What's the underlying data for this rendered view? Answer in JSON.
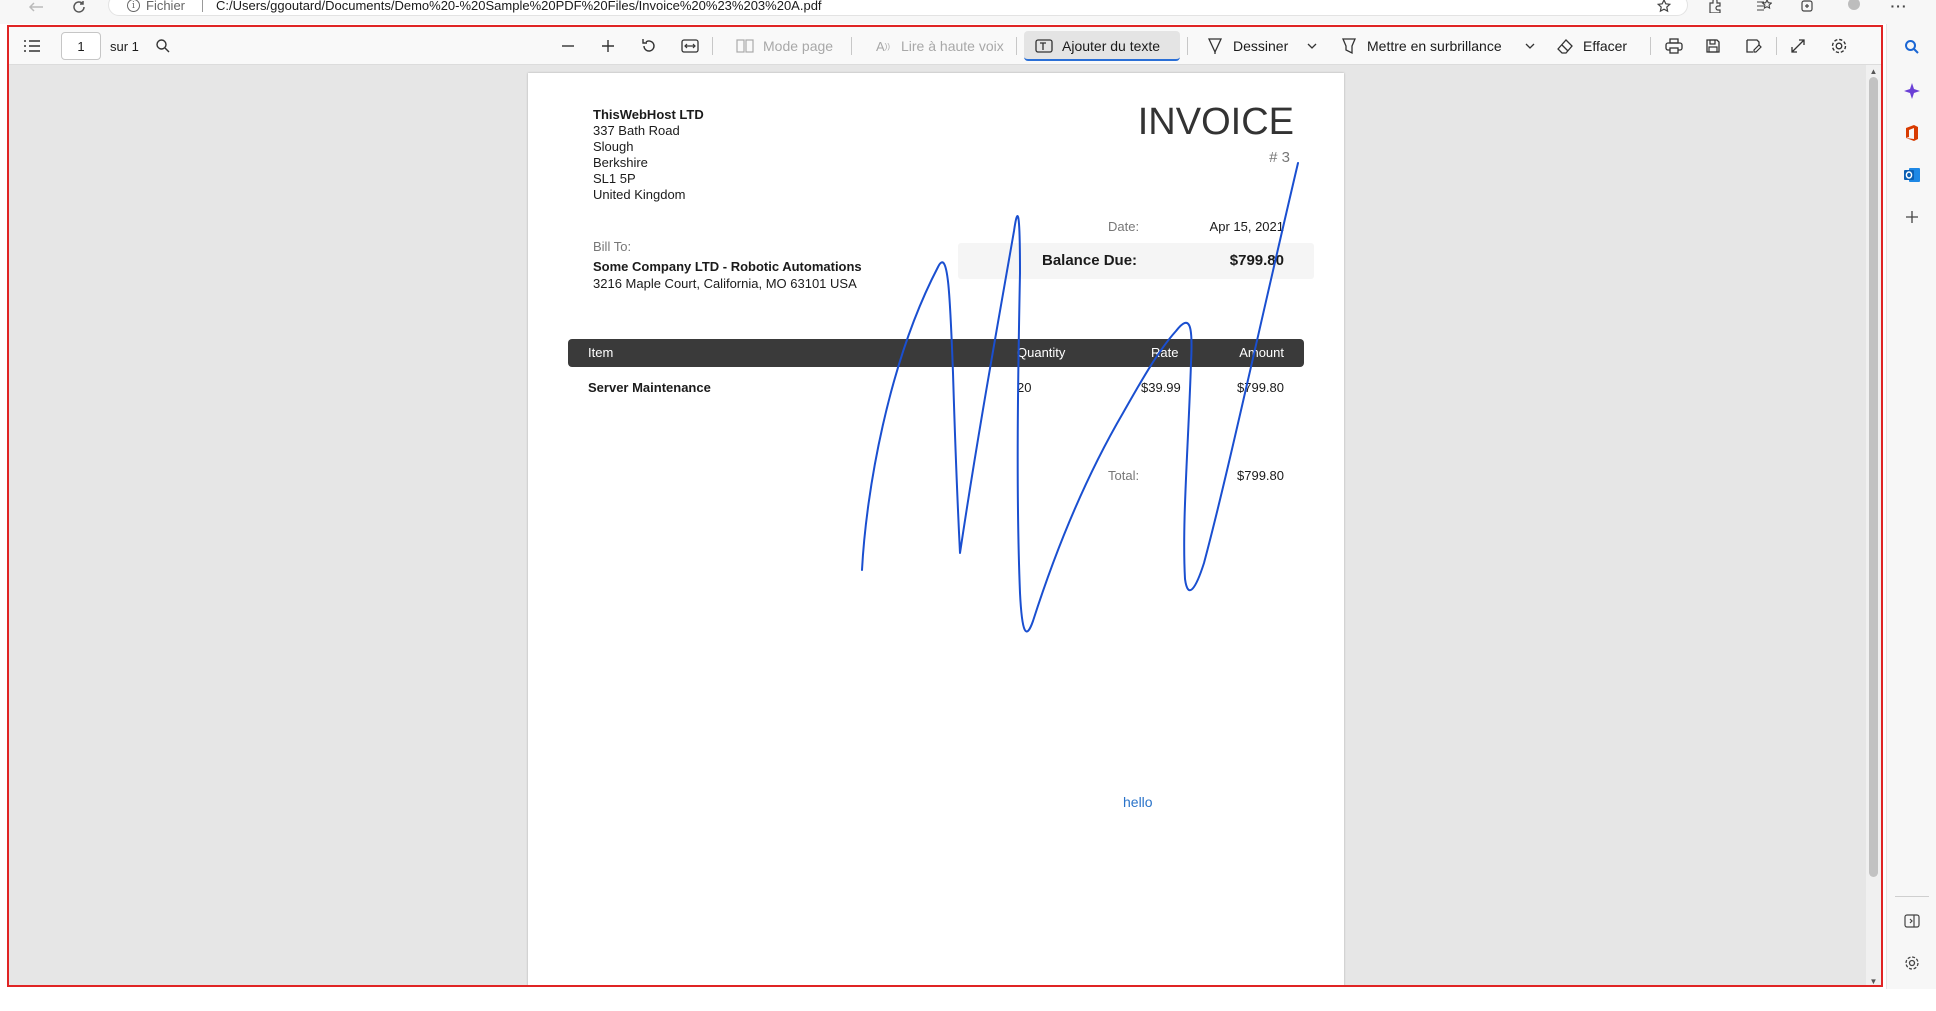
{
  "browser": {
    "url_label": "Fichier",
    "url": "C:/Users/ggoutard/Documents/Demo%20-%20Sample%20PDF%20Files/Invoice%20%23%203%20A.pdf",
    "menu_glyph": "···"
  },
  "toolbar": {
    "page_number": "1",
    "page_total": "sur 1",
    "mode_page": "Mode page",
    "read_aloud": "Lire à haute voix",
    "add_text": "Ajouter du texte",
    "draw": "Dessiner",
    "highlight": "Mettre en surbrillance",
    "erase": "Effacer"
  },
  "invoice": {
    "company": {
      "name": "ThisWebHost LTD",
      "address_lines": [
        "337 Bath Road",
        "Slough",
        "Berkshire",
        "SL1 5P",
        "United Kingdom"
      ]
    },
    "title": "INVOICE",
    "number": "# 3",
    "date_label": "Date:",
    "date_value": "Apr 15, 2021",
    "balance_label": "Balance Due:",
    "balance_value": "$799.80",
    "bill_to_label": "Bill To:",
    "bill_to_name": "Some Company LTD - Robotic Automations",
    "bill_to_address": "3216 Maple Court, California, MO 63101 USA",
    "table_headers": [
      "Item",
      "Quantity",
      "Rate",
      "Amount"
    ],
    "rows": [
      {
        "item": "Server Maintenance",
        "quantity": "20",
        "rate": "$39.99",
        "amount": "$799.80"
      }
    ],
    "total_label": "Total:",
    "total_value": "$799.80",
    "annotation_text": "hello"
  },
  "colors": {
    "ink": "#1a4fd0",
    "frame": "#e02424",
    "table_header_bg": "#3a3a3a",
    "annotation_text": "#2a73c9"
  }
}
